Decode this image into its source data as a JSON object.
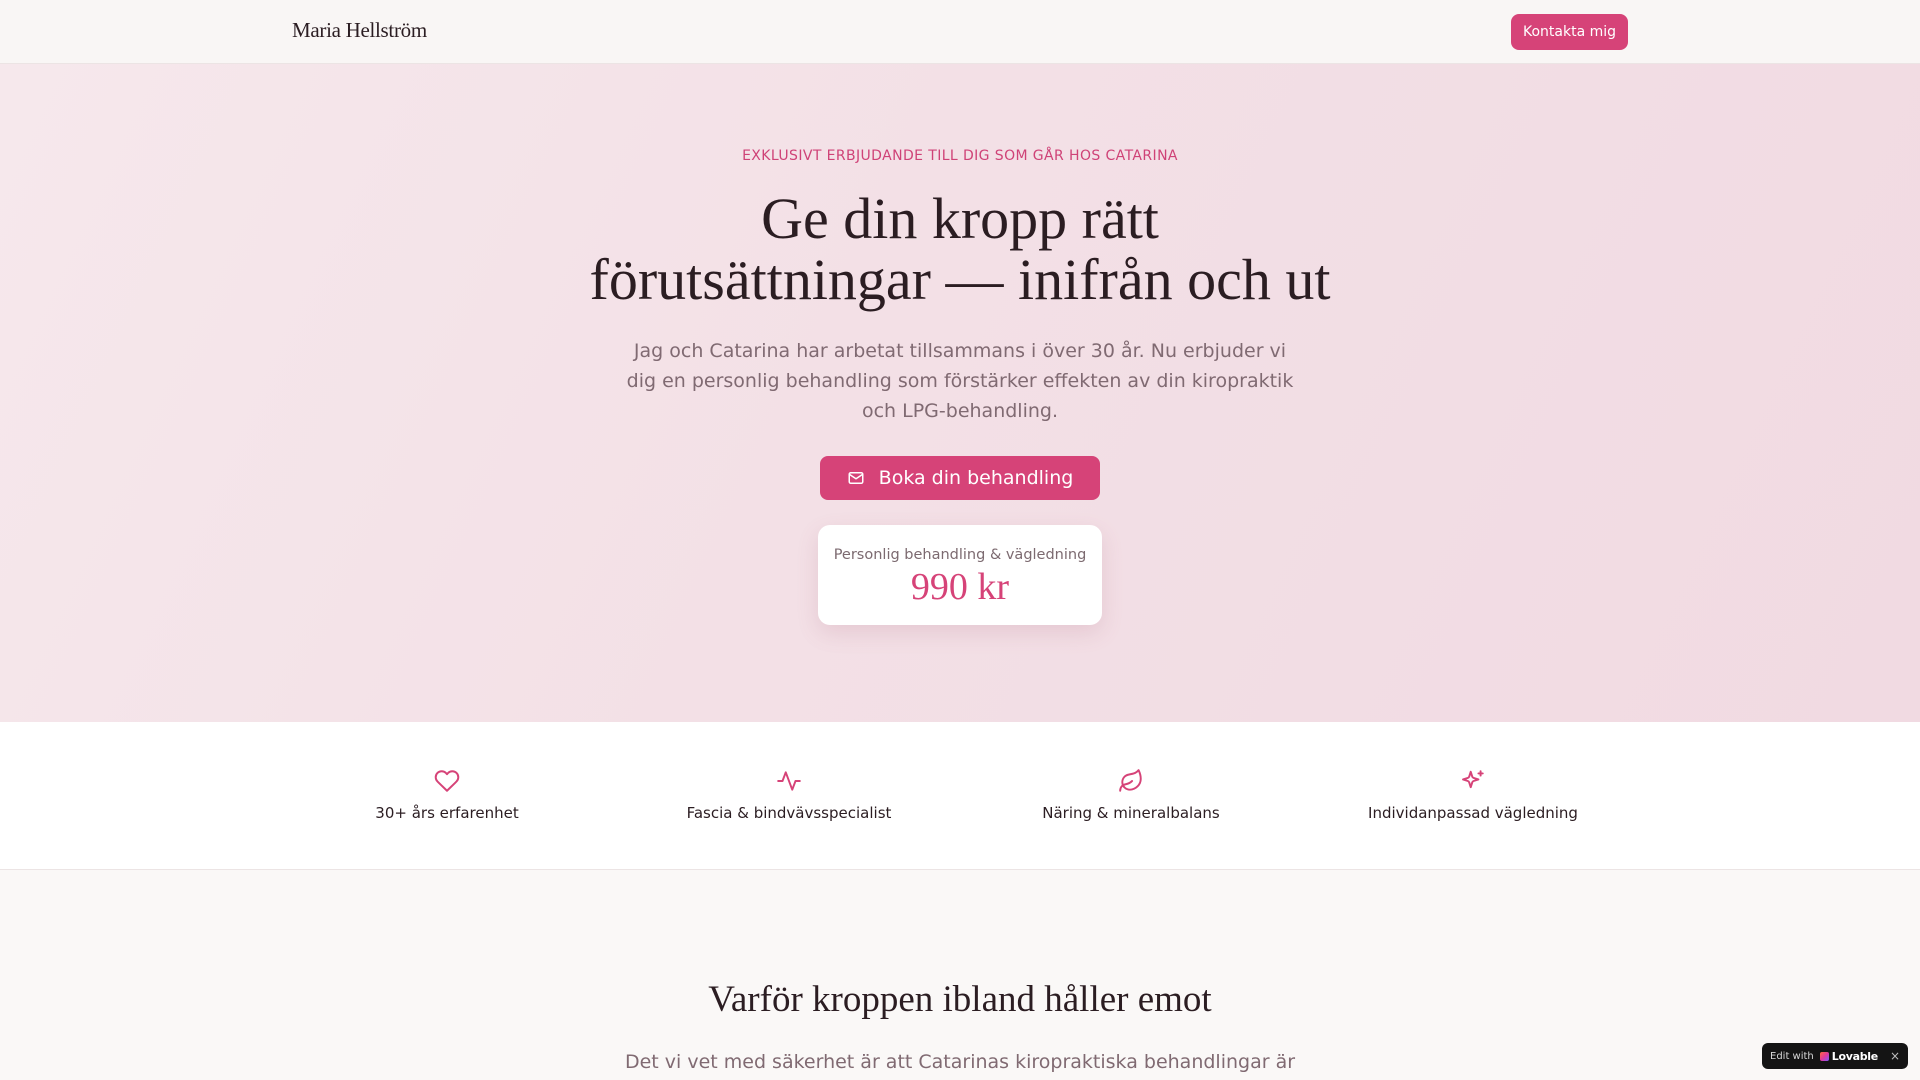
{
  "header": {
    "brand": "Maria Hellström",
    "contact_label": "Kontakta mig"
  },
  "hero": {
    "eyebrow": "EXKLUSIVT ERBJUDANDE TILL DIG SOM GÅR HOS CATARINA",
    "title_line1": "Ge din kropp rätt",
    "title_line2": "förutsättningar — inifrån och ut",
    "subtitle": "Jag och Catarina har arbetat tillsammans i över 30 år. Nu erbjuder vi dig en personlig behandling som förstärker effekten av din kiropraktik och LPG-behandling.",
    "cta_icon": "mail-icon",
    "cta_label": "Boka din behandling",
    "price_label": "Personlig behandling & vägledning",
    "price_value": "990 kr"
  },
  "features": [
    {
      "icon": "heart-icon",
      "label": "30+ års erfarenhet"
    },
    {
      "icon": "activity-icon",
      "label": "Fascia & bindvävsspecialist"
    },
    {
      "icon": "leaf-icon",
      "label": "Näring & mineralbalans"
    },
    {
      "icon": "sparkles-icon",
      "label": "Individanpassad vägledning"
    }
  ],
  "why": {
    "title": "Varför kroppen ibland håller emot",
    "text": "Det vi vet med säkerhet är att Catarinas kiropraktiska behandlingar är"
  },
  "edit_badge": {
    "prefix": "Edit with",
    "brand": "Lovable",
    "close": "×"
  },
  "colors": {
    "accent": "#d64378",
    "text": "#2b1d22",
    "muted": "#806a72",
    "hero_bg": "#f3e0e6"
  }
}
